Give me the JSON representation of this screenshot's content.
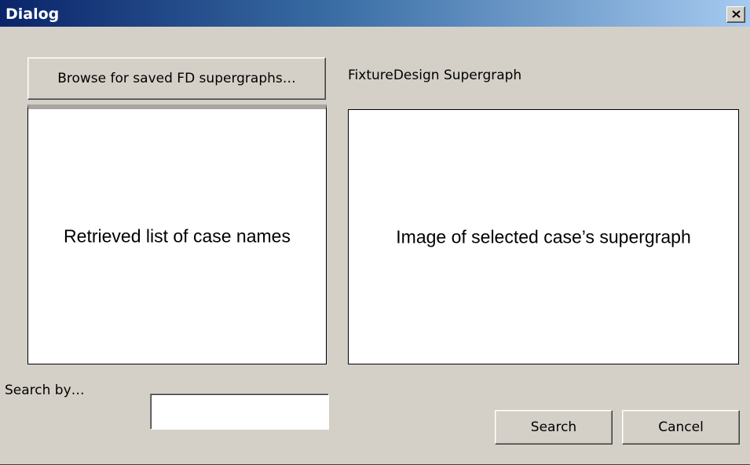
{
  "window": {
    "title": "Dialog",
    "close_icon": "close-icon"
  },
  "top": {
    "browse_label": "Browse for saved FD supergraphs…",
    "supergraph_label": "FixtureDesign Supergraph"
  },
  "panels": {
    "case_list_text": "Retrieved list of case names",
    "image_text": "Image of selected case’s supergraph"
  },
  "search": {
    "label": "Search by…",
    "value": "",
    "search_label": "Search",
    "cancel_label": "Cancel"
  },
  "colors": {
    "dialog_bg": "#d4d0c8",
    "title_gradient_start": "#0a246a",
    "title_gradient_end": "#a6caf0"
  }
}
